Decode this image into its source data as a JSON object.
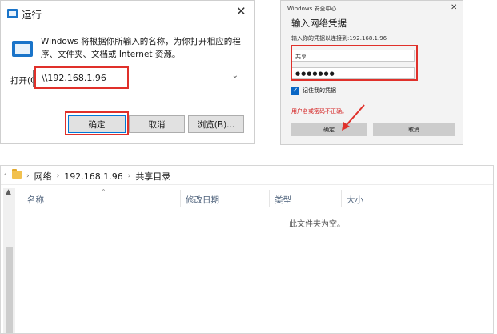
{
  "run_dialog": {
    "title": "运行",
    "description": "Windows 将根据你所输入的名称，为你打开相应的程序、文件夹、文档或 Internet 资源。",
    "open_label": "打开(O):",
    "input_value": "\\\\192.168.1.96",
    "ok": "确定",
    "cancel": "取消",
    "browse": "浏览(B)..."
  },
  "credential_dialog": {
    "title": "Windows 安全中心",
    "heading": "输入网络凭据",
    "prompt": "输入你的凭据以连接到:192.168.1.96",
    "username": "共享",
    "password": "●●●●●●●",
    "remember_label": "记住我的凭据",
    "error": "用户名或密码不正确。",
    "ok": "确定",
    "cancel": "取消"
  },
  "explorer": {
    "breadcrumb": [
      "网络",
      "192.168.1.96",
      "共享目录"
    ],
    "columns": {
      "name": "名称",
      "modified": "修改日期",
      "type": "类型",
      "size": "大小"
    },
    "empty_message": "此文件夹为空。"
  },
  "colors": {
    "highlight": "#e0302a",
    "accent": "#0078d7"
  }
}
